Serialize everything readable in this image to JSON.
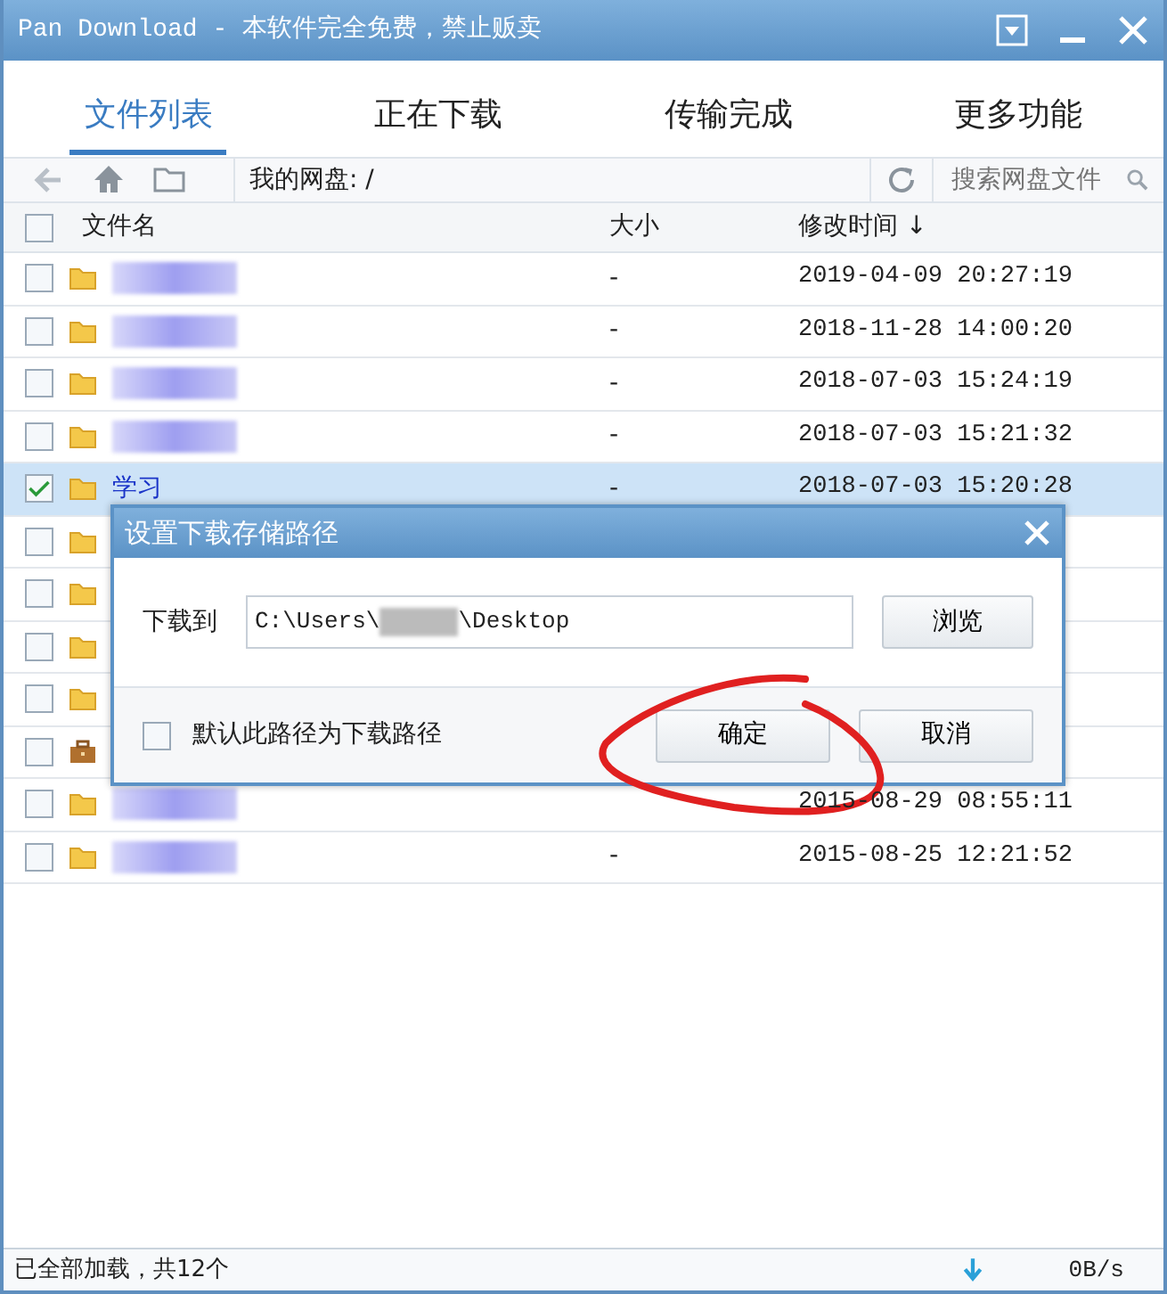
{
  "window": {
    "title": "Pan Download - 本软件完全免费，禁止贩卖"
  },
  "tabs": [
    {
      "label": "文件列表",
      "selected": true
    },
    {
      "label": "正在下载",
      "selected": false
    },
    {
      "label": "传输完成",
      "selected": false
    },
    {
      "label": "更多功能",
      "selected": false
    }
  ],
  "toolbar": {
    "path": "我的网盘: /",
    "search": {
      "placeholder": "搜索网盘文件"
    }
  },
  "table": {
    "select_all_checked": false,
    "columns": [
      "文件名",
      "大小",
      "修改时间 ↓"
    ],
    "rows": [
      {
        "kind": "folder",
        "redacted": true,
        "checked": false,
        "selected": false,
        "size": "-",
        "modified": "2019-04-09 20:27:19"
      },
      {
        "kind": "folder",
        "redacted": true,
        "checked": false,
        "selected": false,
        "size": "-",
        "modified": "2018-11-28 14:00:20"
      },
      {
        "kind": "folder",
        "redacted": true,
        "checked": false,
        "selected": false,
        "size": "-",
        "modified": "2018-07-03 15:24:19"
      },
      {
        "kind": "folder",
        "redacted": true,
        "checked": false,
        "selected": false,
        "size": "-",
        "modified": "2018-07-03 15:21:32"
      },
      {
        "kind": "folder",
        "name": "学习",
        "checked": true,
        "selected": true,
        "size": "-",
        "modified": "2018-07-03 15:20:28"
      },
      {
        "kind": "folder",
        "checked": false,
        "selected": false
      },
      {
        "kind": "folder",
        "checked": false,
        "selected": false
      },
      {
        "kind": "folder",
        "checked": false,
        "selected": false
      },
      {
        "kind": "folder",
        "checked": false,
        "selected": false
      },
      {
        "kind": "briefcase",
        "checked": false,
        "selected": false
      },
      {
        "kind": "folder",
        "redacted": true,
        "checked": false,
        "selected": false,
        "modified": "2015-08-29 08:55:11"
      },
      {
        "kind": "folder",
        "redacted": true,
        "checked": false,
        "selected": false,
        "size": "-",
        "modified": "2015-08-25 12:21:52"
      }
    ]
  },
  "dialog": {
    "title": "设置下载存储路径",
    "label": "下载到",
    "path_start": "C:\\Users\\",
    "path_end": "\\Desktop",
    "browse": "浏览",
    "default_label": "默认此路径为下载路径",
    "default_checked": false,
    "ok": "确定",
    "cancel": "取消"
  },
  "status_bar": {
    "text": "已全部加载，共12个",
    "speed": "0B/s"
  }
}
